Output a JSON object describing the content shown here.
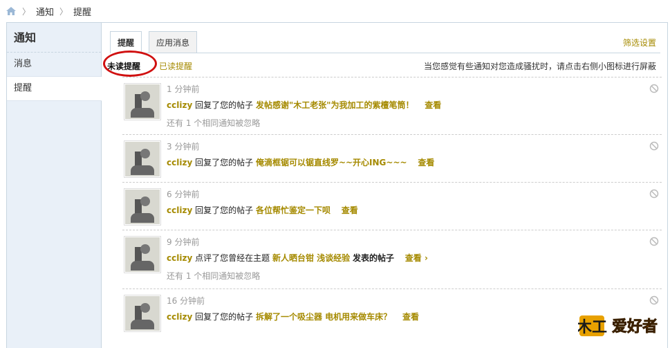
{
  "breadcrumb": {
    "items": [
      "通知",
      "提醒"
    ],
    "home_icon": "home-icon"
  },
  "sidebar": {
    "title": "通知",
    "items": [
      {
        "label": "消息",
        "active": false
      },
      {
        "label": "提醒",
        "active": true
      }
    ]
  },
  "tabs": [
    {
      "label": "提醒",
      "active": true
    },
    {
      "label": "应用消息",
      "active": false
    }
  ],
  "filter_label": "筛选设置",
  "subnav": {
    "unread_label": "未读提醒",
    "read_label": "已读提醒",
    "hint": "当您感觉有些通知对您造成骚扰时，请点击右侧小图标进行屏蔽"
  },
  "notices": [
    {
      "time": "1 分钟前",
      "user": "cclizy",
      "action": "回复了您的帖子",
      "topic": "发帖感谢\"木工老张\"为我加工的紫檀笔筒！",
      "after": "",
      "view": "查看",
      "ignored": "还有 1 个相同通知被忽略"
    },
    {
      "time": "3 分钟前",
      "user": "cclizy",
      "action": "回复了您的帖子",
      "topic": "俺滴框锯可以锯直线罗~~开心ING~~~",
      "after": "",
      "view": "查看",
      "ignored": ""
    },
    {
      "time": "6 分钟前",
      "user": "cclizy",
      "action": "回复了您的帖子",
      "topic": "各位帮忙鉴定一下呗",
      "after": "",
      "view": "查看",
      "ignored": ""
    },
    {
      "time": "9 分钟前",
      "user": "cclizy",
      "action": "点评了您曾经在主题",
      "topic": "新人晒台钳 浅谈经验",
      "after": "发表的帖子",
      "view": "查看 ›",
      "ignored": "还有 1 个相同通知被忽略"
    },
    {
      "time": "16 分钟前",
      "user": "cclizy",
      "action": "回复了您的帖子",
      "topic": "拆解了一个吸尘器 电机用来做车床？",
      "after": "",
      "view": "查看",
      "ignored": ""
    }
  ],
  "logo_text": "木工爱好者",
  "colors": {
    "link": "#a58a00",
    "sidebar_bg": "#e9f0f8",
    "border": "#c7d5e0",
    "circle": "#d01010"
  }
}
